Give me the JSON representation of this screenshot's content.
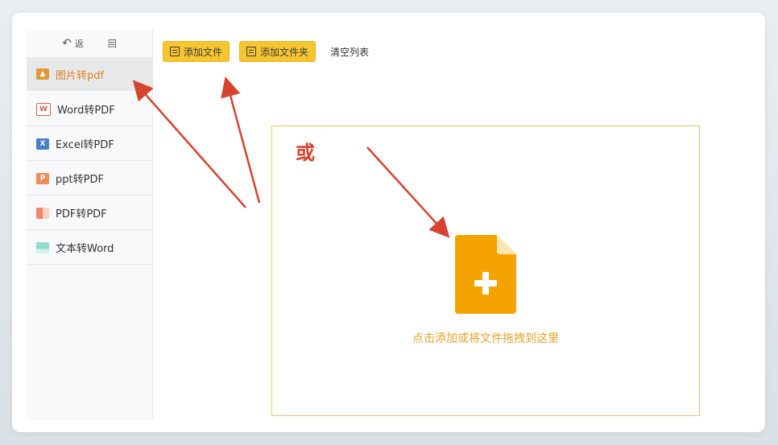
{
  "sidebar": {
    "back_label": "返",
    "home_label": "回",
    "items": [
      {
        "label": "图片转pdf",
        "icon": "image-icon",
        "active": true
      },
      {
        "label": "Word转PDF",
        "icon": "word-icon"
      },
      {
        "label": "Excel转PDF",
        "icon": "excel-icon"
      },
      {
        "label": "ppt转PDF",
        "icon": "ppt-icon"
      },
      {
        "label": "PDF转PDF",
        "icon": "pdf-icon"
      },
      {
        "label": "文本转Word",
        "icon": "text-icon"
      }
    ]
  },
  "toolbar": {
    "add_file_label": "添加文件",
    "add_folder_label": "添加文件夹",
    "clear_list_label": "清空列表"
  },
  "dropzone": {
    "or_label": "或",
    "hint": "点击添加或将文件拖拽到这里"
  },
  "colors": {
    "accent": "#f7c530",
    "annotation": "#d8432f",
    "file_icon": "#f5a300",
    "hint": "#e3a32a"
  }
}
